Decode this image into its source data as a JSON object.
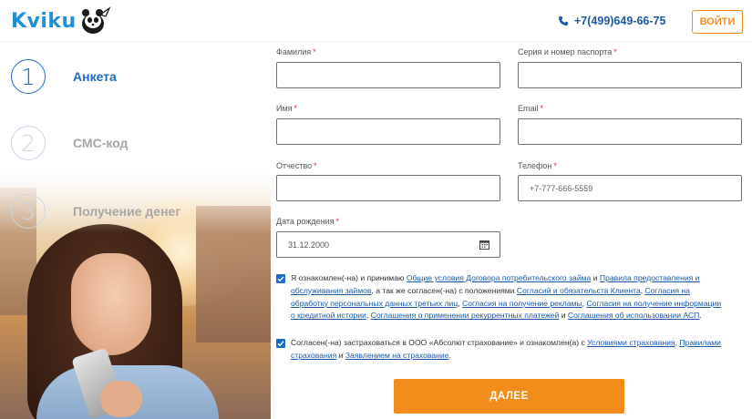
{
  "header": {
    "logo_text": "Kviku",
    "phone": "+7(499)649-66-75",
    "login_label": "ВОЙТИ"
  },
  "steps": [
    {
      "number": "1",
      "label": "Анкета",
      "active": true
    },
    {
      "number": "2",
      "label": "СМС-код",
      "active": false
    },
    {
      "number": "3",
      "label": "Получение денег",
      "active": false
    }
  ],
  "form": {
    "last_name": {
      "label": "Фамилия",
      "value": ""
    },
    "passport": {
      "label": "Серия и номер паспорта",
      "value": ""
    },
    "first_name": {
      "label": "Имя",
      "value": ""
    },
    "email": {
      "label": "Email",
      "value": ""
    },
    "patronymic": {
      "label": "Отчество",
      "value": ""
    },
    "phone": {
      "label": "Телефон",
      "placeholder": "+7-777-666-5559"
    },
    "birth_date": {
      "label": "Дата рождения",
      "value": "31.12.2000"
    },
    "required_mark": "*"
  },
  "consent1": {
    "checked": true,
    "t1": "Я ознакомлен(-на) и принимаю ",
    "l1": "Общие условия Договора потребительского займа",
    "t2": " и ",
    "l2": "Правила предоставления и обслуживания займов",
    "t3": ", а так же согласен(-на) с положениями ",
    "l3": "Согласий и обязательств Клиента",
    "t4": ", ",
    "l4": "Согласия на обработку персональных данных третьих лиц",
    "t5": ", ",
    "l5": "Согласия на получение рекламы",
    "t6": ", ",
    "l6": "Согласия на получение информации о кредитной истории",
    "t7": ", ",
    "l7": "Соглашения о применении рекуррентных платежей",
    "t8": " и ",
    "l8": "Соглашения об использовании АСП",
    "t9": "."
  },
  "consent2": {
    "checked": true,
    "t1": "Согласен(-на) застраховаться в ООО «Абсолют страхование» и ознакомлен(а) с ",
    "l1": "Условиями страхования",
    "t2": ", ",
    "l2": "Правилами страхования",
    "t3": " и ",
    "l3": "Заявлением на страхование",
    "t4": "."
  },
  "submit_label": "ДАЛЕЕ",
  "colors": {
    "brand_blue": "#1a6cc4",
    "accent_orange": "#f28c1b"
  }
}
